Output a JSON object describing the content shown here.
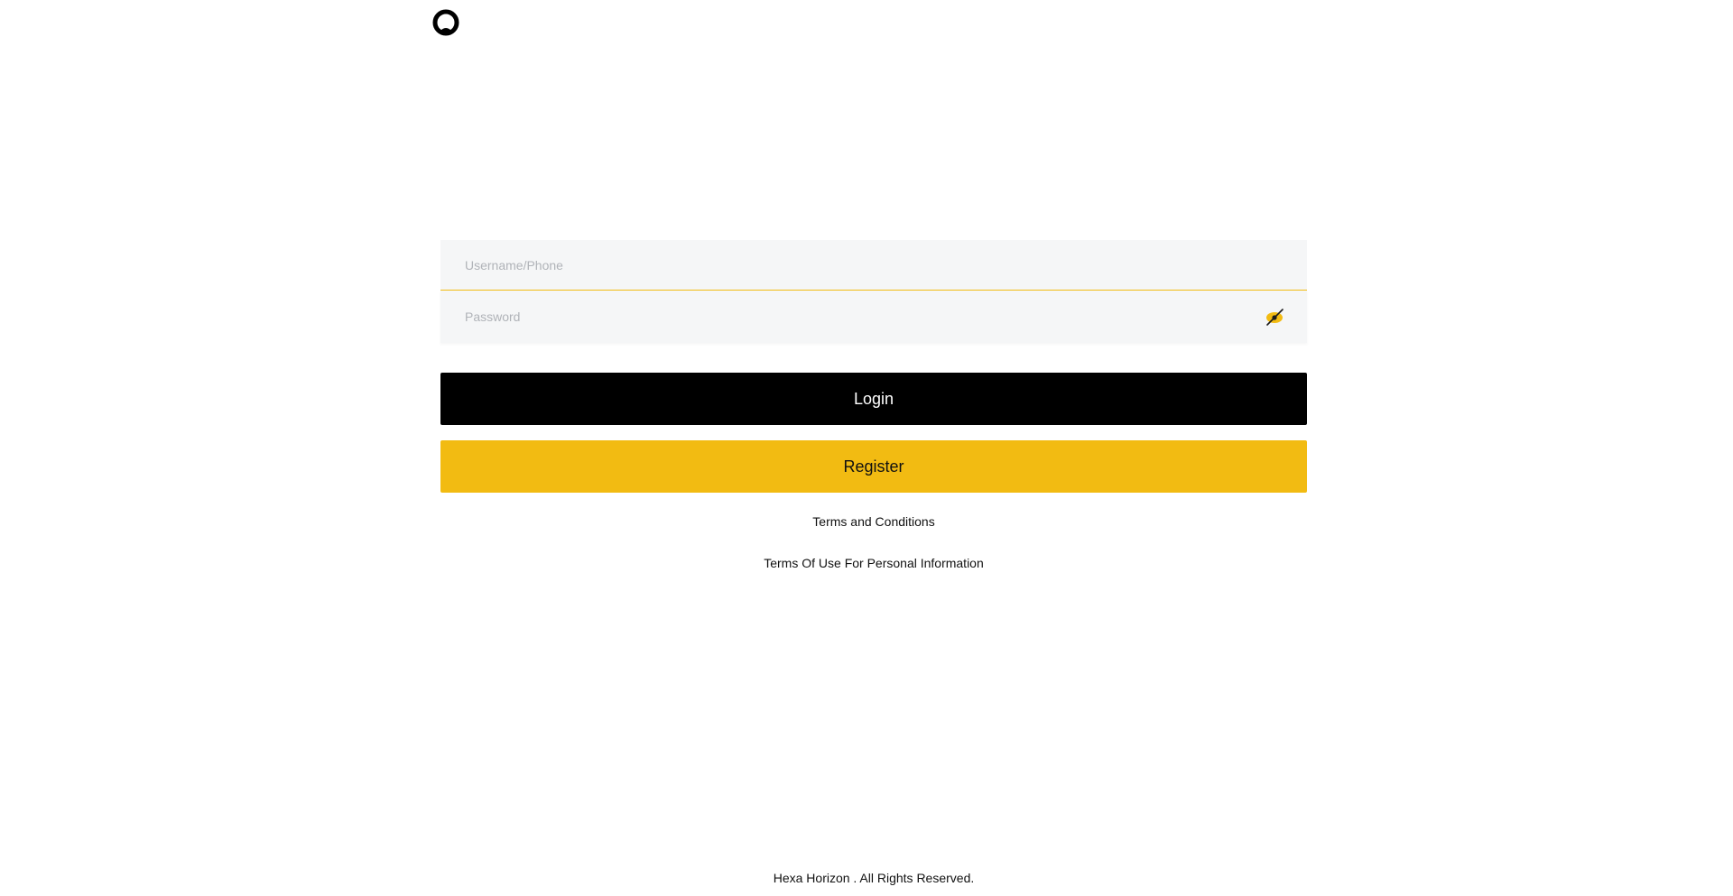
{
  "header": {
    "logo_icon": "circle-logo-icon"
  },
  "login_form": {
    "username_placeholder": "Username/Phone",
    "username_value": "",
    "password_placeholder": "Password",
    "password_value": "",
    "password_toggle_icon": "eye-off-icon",
    "login_label": "Login",
    "register_label": "Register",
    "terms_link": "Terms and Conditions",
    "privacy_link": "Terms Of Use For Personal Information"
  },
  "footer": {
    "copyright": "Hexa Horizon . All Rights Reserved."
  },
  "colors": {
    "accent": "#f2bb12",
    "primary_button": "#000000",
    "field_background": "#f5f6f7",
    "placeholder": "#b0b3b8"
  }
}
